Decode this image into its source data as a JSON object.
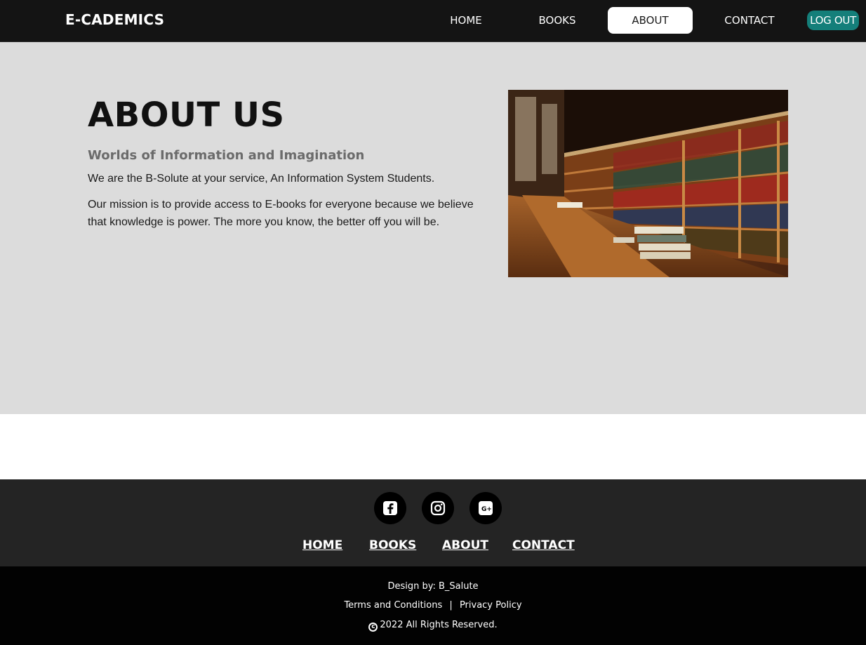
{
  "nav": {
    "brand": "E-CADEMICS",
    "links": [
      "HOME",
      "BOOKS",
      "ABOUT",
      "CONTACT"
    ],
    "active": "ABOUT",
    "logout": "LOG OUT",
    "colors": {
      "background": "#141414",
      "logout": "#147f7a",
      "active_bg": "#ffffff"
    }
  },
  "about": {
    "title": "ABOUT US",
    "subtitle": "Worlds of Information and Imagination",
    "paragraph1": "We are the B-Solute at your service, An Information System Students.",
    "paragraph2": "Our mission is to provide access to E-books for everyone because we believe that knowledge is power. The more you know, the better off you will be.",
    "background": "#dcdcdc"
  },
  "footer": {
    "social_icons": [
      "facebook-icon",
      "instagram-icon",
      "google-plus-icon"
    ],
    "links": [
      "HOME",
      "BOOKS",
      "ABOUT",
      "CONTACT"
    ],
    "design_by": "Design by: B_Salute",
    "terms": "Terms and Conditions",
    "separator": "|",
    "privacy": "Privacy Policy",
    "rights": "2022 All Rights Reserved."
  }
}
